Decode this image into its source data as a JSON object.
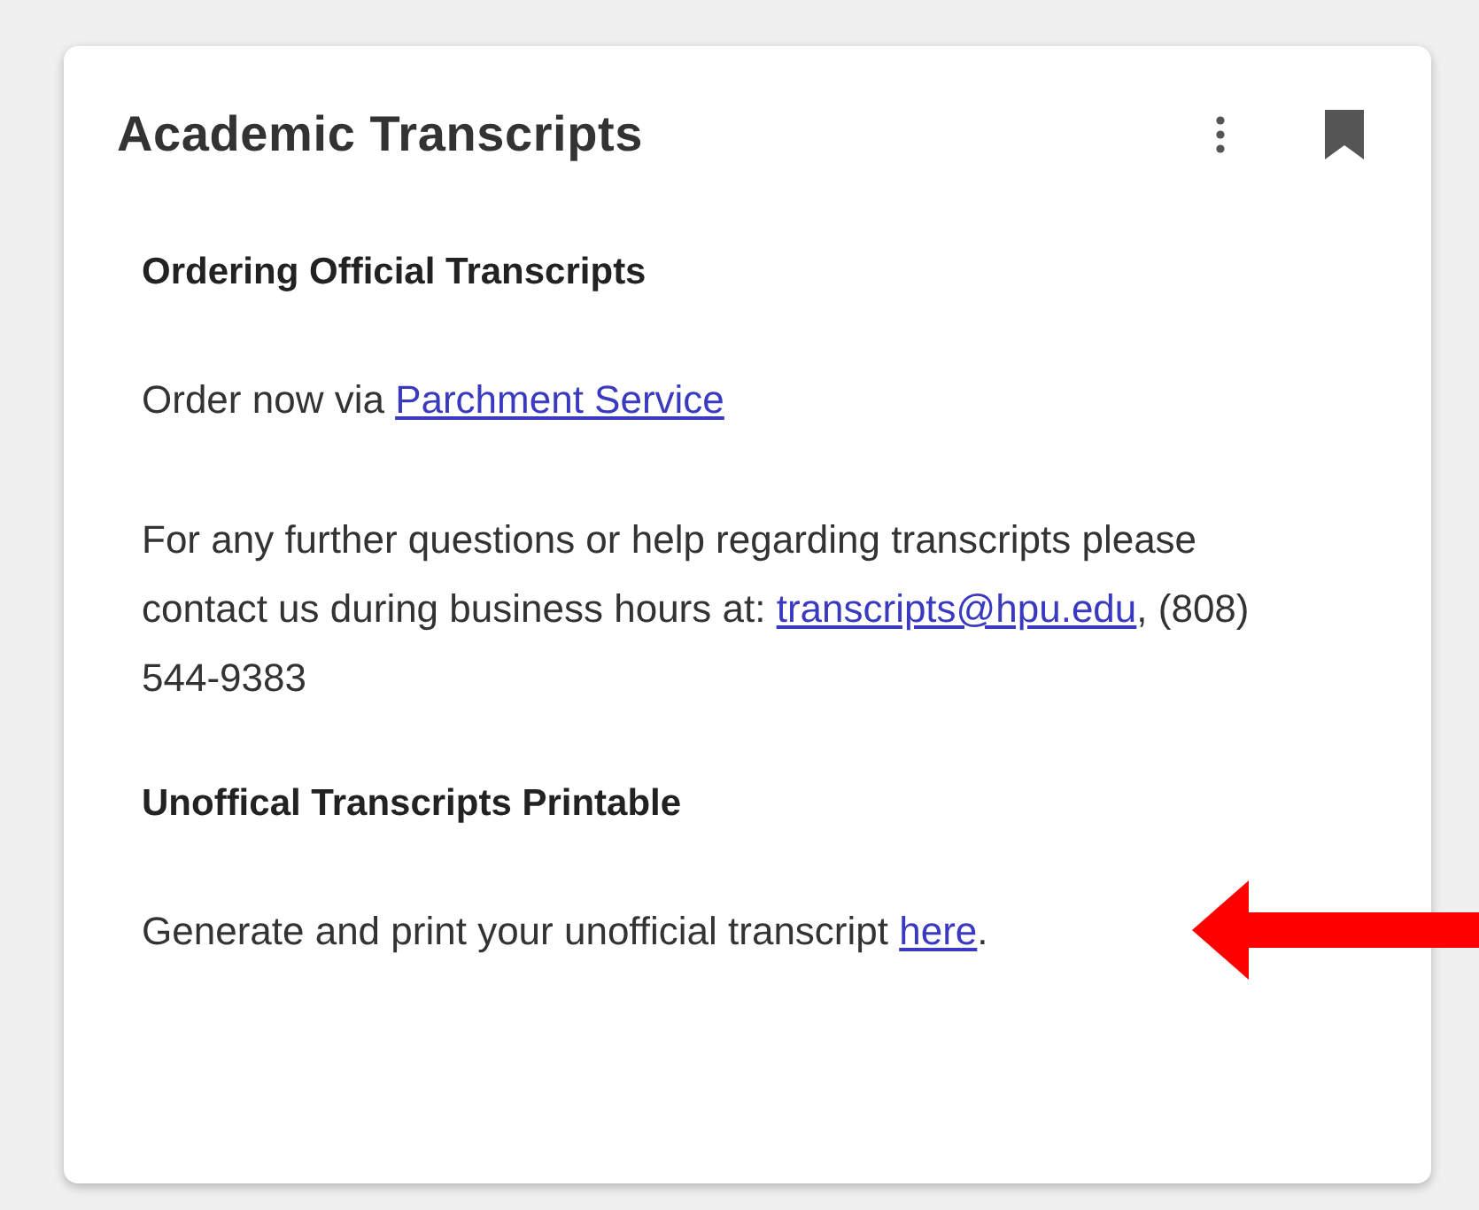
{
  "card": {
    "title": "Academic Transcripts"
  },
  "sections": [
    {
      "heading": "Ordering Official Transcripts",
      "paragraphs": [
        [
          {
            "kind": "text",
            "text": "Order now via "
          },
          {
            "kind": "link",
            "text": "Parchment Service"
          }
        ],
        [
          {
            "kind": "text",
            "text": "For any further questions or help regarding transcripts please contact us during business hours at: "
          },
          {
            "kind": "link",
            "text": "transcripts@hpu.edu"
          },
          {
            "kind": "text",
            "text": ", (808) 544-9383"
          }
        ]
      ]
    },
    {
      "heading": "Unoffical Transcripts Printable",
      "paragraphs": [
        [
          {
            "kind": "text",
            "text": "Generate and print your unofficial transcript "
          },
          {
            "kind": "link",
            "text": "here"
          },
          {
            "kind": "text",
            "text": "."
          }
        ]
      ]
    }
  ]
}
